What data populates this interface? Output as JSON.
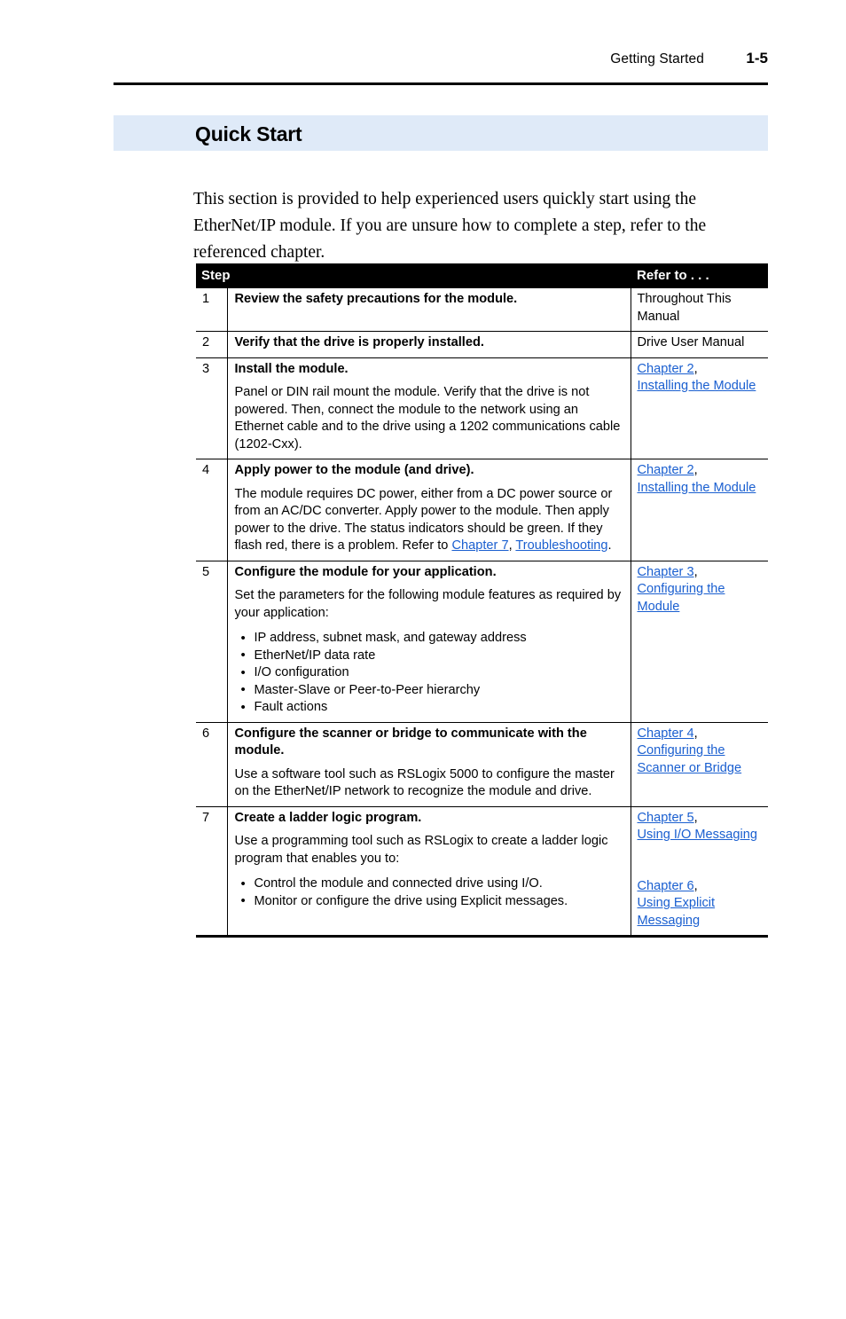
{
  "header": {
    "chapter_name": "Getting Started",
    "page_number": "1-5"
  },
  "section": {
    "title": "Quick Start",
    "band_color": "#dfeaf8"
  },
  "intro": "This section is provided to help experienced users quickly start using the EtherNet/IP module. If you are unsure how to complete a step, refer to the referenced chapter.",
  "table": {
    "columns": [
      "Step",
      "",
      "Refer to . . ."
    ],
    "headers": {
      "step": "Step",
      "description": "",
      "refer": "Refer to . . ."
    },
    "link_color": "#1a5fd0",
    "rows": [
      {
        "step": "1",
        "title": "Review the safety precautions for the module.",
        "body": "",
        "refer_text": "Throughout This Manual"
      },
      {
        "step": "2",
        "title": "Verify that the drive is properly installed.",
        "body": "",
        "refer_text": "Drive User Manual"
      },
      {
        "step": "3",
        "title": "Install the module.",
        "body": "Panel or DIN rail mount the module. Verify that the drive is not powered. Then, connect the module to the network using an Ethernet cable and to the drive using a 1202 communications cable (1202-Cxx).",
        "refer_links": [
          "Chapter 2",
          "Installing the Module"
        ]
      },
      {
        "step": "4",
        "title": "Apply power to the module (and drive).",
        "body_part1": "The module requires DC power, either from a DC power source or from an AC/DC converter. Apply power to the module. Then apply power to the drive. The status indicators should be green. If they flash red, there is a problem. Refer to ",
        "body_link1": "Chapter 7",
        "body_sep": ", ",
        "body_link2": "Troubleshooting",
        "body_end": ".",
        "refer_links": [
          "Chapter 2",
          "Installing the Module"
        ]
      },
      {
        "step": "5",
        "title": "Configure the module for your application.",
        "body": "Set the parameters for the following module features as required by your application:",
        "bullets": [
          "IP address, subnet mask, and gateway address",
          "EtherNet/IP data rate",
          "I/O configuration",
          "Master-Slave or Peer-to-Peer hierarchy",
          "Fault actions"
        ],
        "refer_links": [
          "Chapter 3",
          "Configuring the Module"
        ]
      },
      {
        "step": "6",
        "title": "Configure the scanner or bridge to communicate with the module.",
        "body": "Use a software tool such as RSLogix 5000 to configure the master on the EtherNet/IP network to recognize the module and drive.",
        "refer_links": [
          "Chapter 4",
          "Configuring the Scanner or Bridge"
        ]
      },
      {
        "step": "7",
        "title": "Create a ladder logic program.",
        "body": "Use a programming tool such as RSLogix to create a ladder logic program that enables you to:",
        "bullets": [
          "Control the module and connected drive using I/O.",
          "Monitor or configure the drive using Explicit messages."
        ],
        "refer_links_group1": [
          "Chapter 5",
          "Using I/O Messaging"
        ],
        "refer_links_group2": [
          "Chapter 6",
          "Using Explicit Messaging"
        ]
      }
    ]
  }
}
